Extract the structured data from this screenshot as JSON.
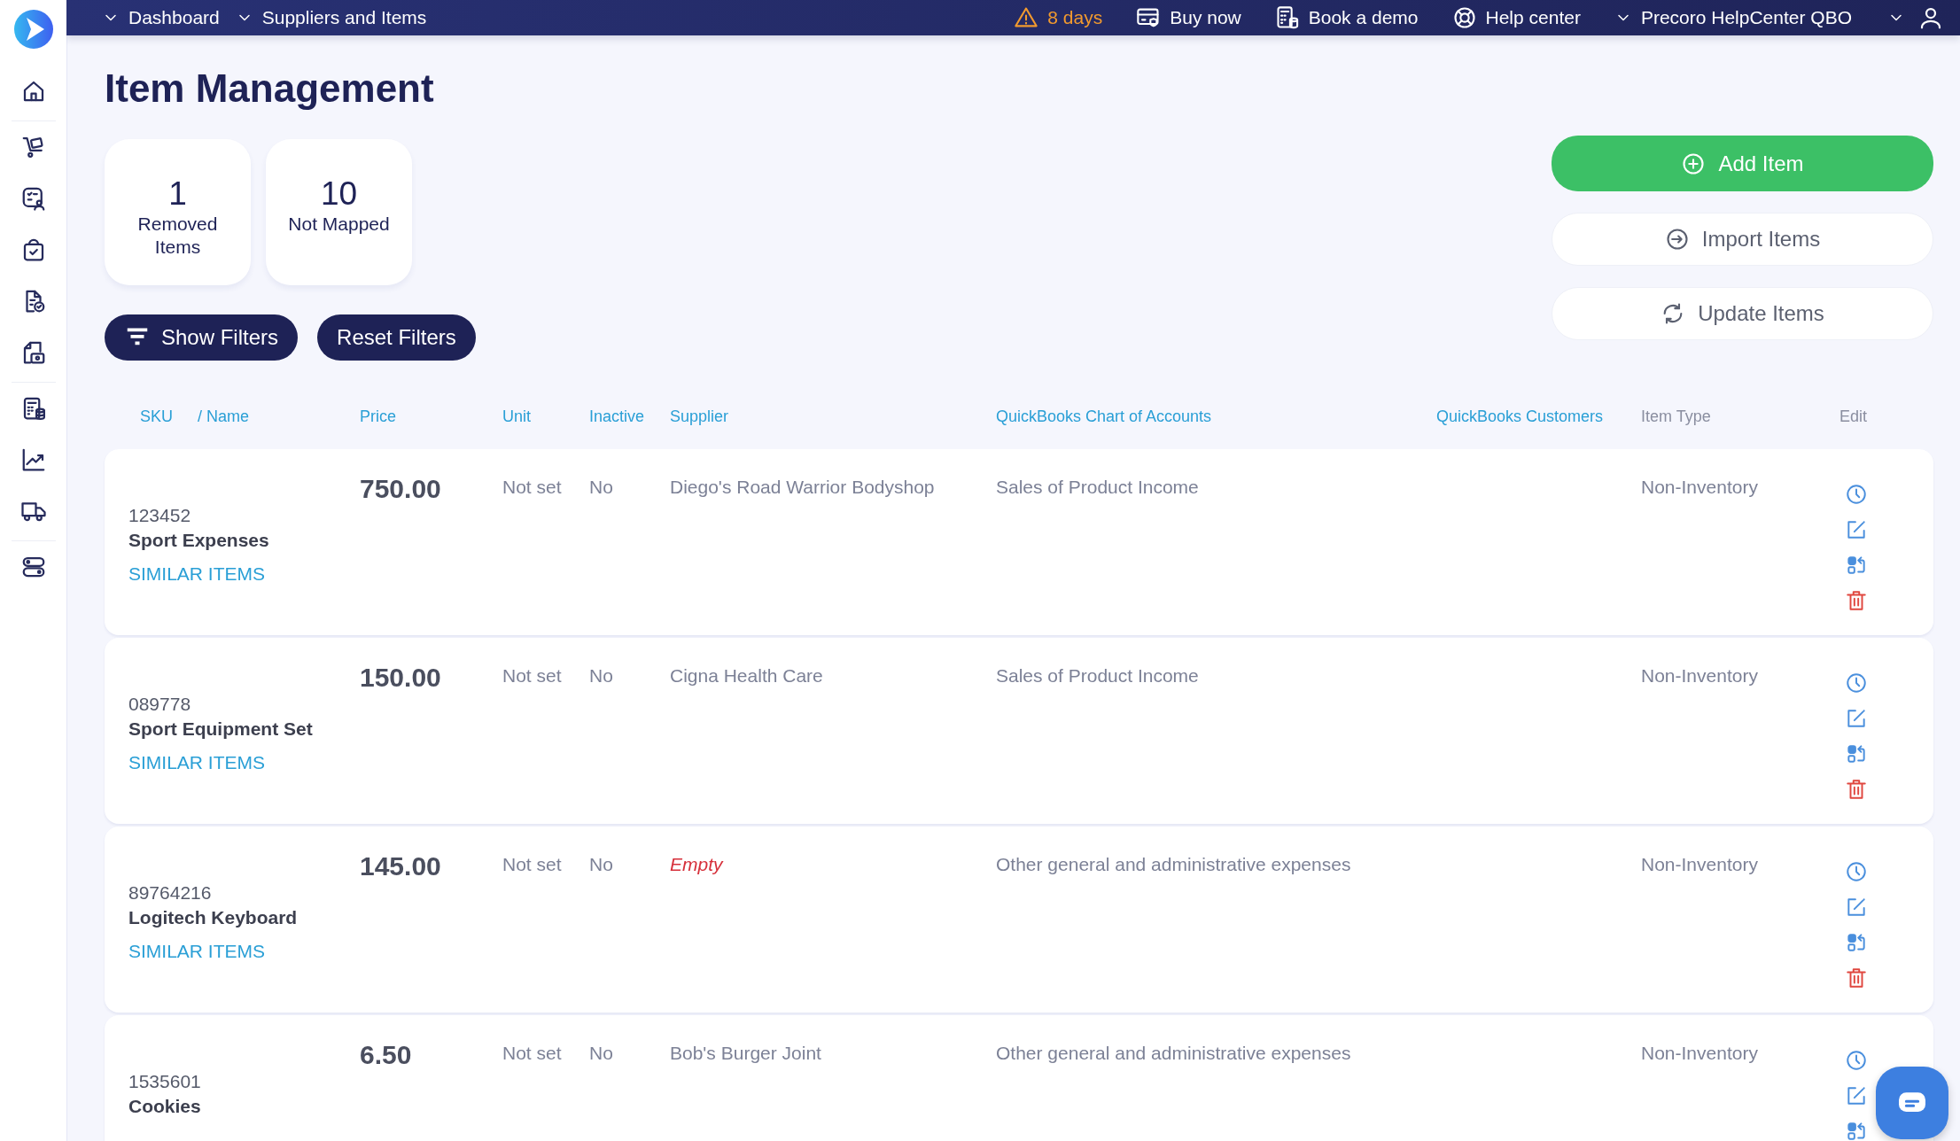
{
  "top_bar": {
    "breadcrumbs": [
      "Dashboard",
      "Suppliers and Items"
    ],
    "trial": "8 days",
    "links": [
      {
        "label": "Buy now",
        "kind": "buy"
      },
      {
        "label": "Book a demo",
        "kind": "demo"
      },
      {
        "label": "Help center",
        "kind": "help"
      }
    ],
    "company": "Precoro HelpCenter QBO"
  },
  "page_title": "Item Management",
  "stats": [
    {
      "count": "1",
      "label": "Removed Items"
    },
    {
      "count": "10",
      "label": "Not Mapped"
    }
  ],
  "filter_buttons": [
    {
      "label": "Show Filters",
      "kind": "show"
    },
    {
      "label": "Reset Filters",
      "kind": "reset"
    }
  ],
  "actions": [
    {
      "label": "Add Item",
      "kind": "add"
    },
    {
      "label": "Import Items",
      "kind": "import"
    },
    {
      "label": "Update Items",
      "kind": "update"
    }
  ],
  "table": {
    "columns": [
      {
        "label": "SKU",
        "sortable": true
      },
      {
        "label": "/ Name",
        "sortable": true
      },
      {
        "label": "Price",
        "sortable": true
      },
      {
        "label": "Unit",
        "sortable": true
      },
      {
        "label": "Inactive",
        "sortable": true
      },
      {
        "label": "Supplier",
        "sortable": true
      },
      {
        "label": "QuickBooks Chart of Accounts",
        "sortable": true
      },
      {
        "label": "QuickBooks Customers",
        "sortable": true
      },
      {
        "label": "Item Type",
        "sortable": false
      },
      {
        "label": "Edit",
        "sortable": false
      }
    ],
    "rows": [
      {
        "sku": "123452",
        "name": "Sport Expenses",
        "link": "SIMILAR ITEMS",
        "price": "750.00",
        "unit": "Not set",
        "inactive": "No",
        "supplier": "Diego's Road Warrior Bodyshop",
        "supplier_empty": false,
        "account": "Sales of Product Income",
        "item_type": "Non-Inventory"
      },
      {
        "sku": "089778",
        "name": "Sport Equipment Set",
        "link": "SIMILAR ITEMS",
        "price": "150.00",
        "unit": "Not set",
        "inactive": "No",
        "supplier": "Cigna Health Care",
        "supplier_empty": false,
        "account": "Sales of Product Income",
        "item_type": "Non-Inventory"
      },
      {
        "sku": "89764216",
        "name": "Logitech Keyboard",
        "link": "SIMILAR ITEMS",
        "price": "145.00",
        "unit": "Not set",
        "inactive": "No",
        "supplier": "Empty",
        "supplier_empty": true,
        "account": "Other general and administrative expenses",
        "item_type": "Non-Inventory"
      },
      {
        "sku": "1535601",
        "name": "Cookies",
        "price": "6.50",
        "unit": "Not set",
        "inactive": "No",
        "supplier": "Bob's Burger Joint",
        "supplier_empty": false,
        "account": "Other general and administrative expenses",
        "item_type": "Non-Inventory"
      }
    ]
  }
}
